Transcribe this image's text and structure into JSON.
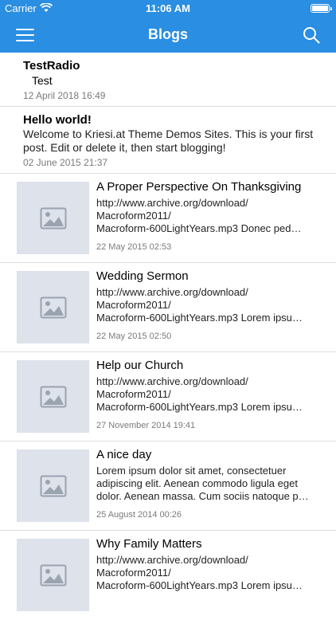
{
  "status_bar": {
    "carrier": "Carrier",
    "time": "11:06 AM"
  },
  "nav": {
    "title": "Blogs"
  },
  "text_posts": [
    {
      "title": "TestRadio",
      "subtitle": "Test",
      "excerpt": "",
      "date": "12 April 2018 16:49"
    },
    {
      "title": "Hello world!",
      "subtitle": "",
      "excerpt": "Welcome to Kriesi.at Theme Demos Sites. This is your first post. Edit or delete it, then start blogging!",
      "date": "02 June 2015 21:37"
    }
  ],
  "media_posts": [
    {
      "title": "A Proper Perspective On Thanksgiving",
      "excerpt": "http://www.archive.org/download/\nMacroform2011/\nMacroform-600LightYears.mp3  Donec ped…",
      "date": "22 May 2015 02:53"
    },
    {
      "title": "Wedding Sermon",
      "excerpt": "http://www.archive.org/download/\nMacroform2011/\nMacroform-600LightYears.mp3  Lorem ipsu…",
      "date": "22 May 2015 02:50"
    },
    {
      "title": "Help our Church",
      "excerpt": "http://www.archive.org/download/\nMacroform2011/\nMacroform-600LightYears.mp3  Lorem ipsu…",
      "date": "27 November 2014 19:41"
    },
    {
      "title": "A nice day",
      "excerpt": "Lorem ipsum dolor sit amet, consectetuer\nadipiscing elit. Aenean commodo ligula eget\ndolor. Aenean massa. Cum sociis natoque p…",
      "date": "25 August 2014 00:26"
    },
    {
      "title": "Why Family Matters",
      "excerpt": "http://www.archive.org/download/\nMacroform2011/\nMacroform-600LightYears.mp3  Lorem ipsu…",
      "date": ""
    }
  ]
}
